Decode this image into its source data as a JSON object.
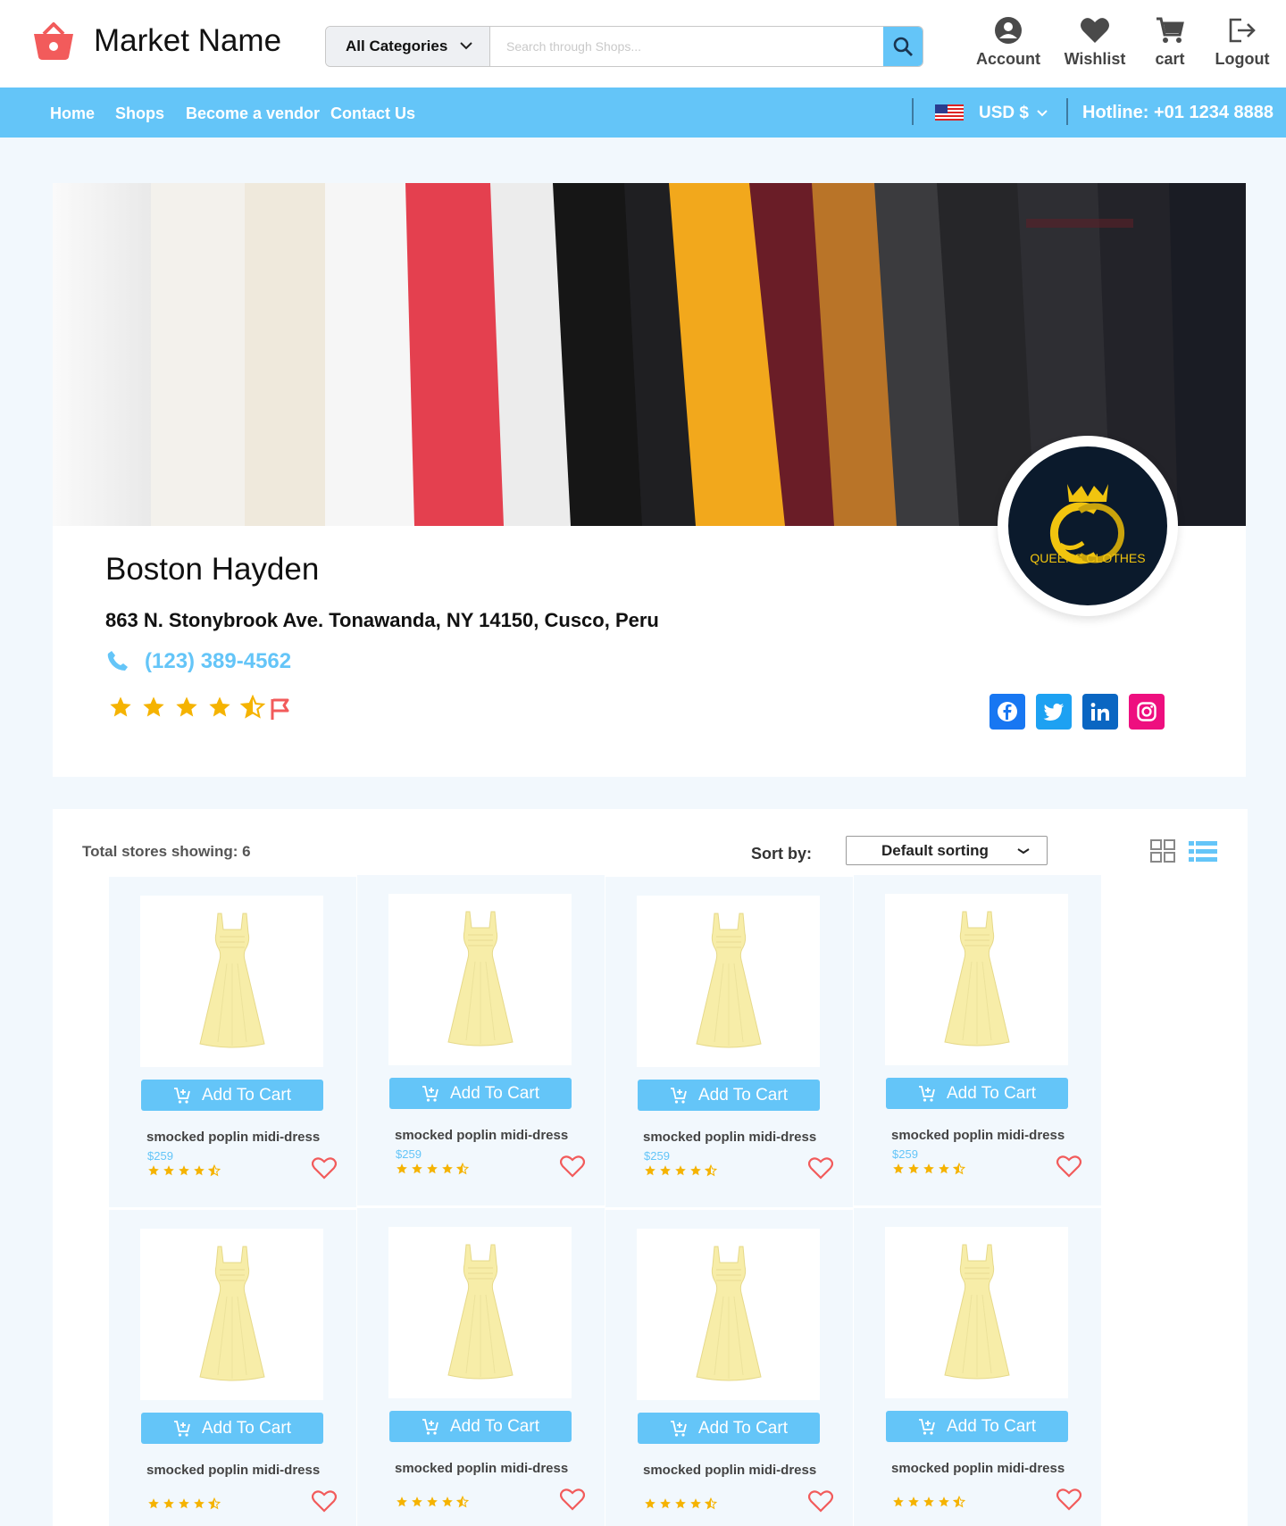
{
  "header": {
    "brand": "Market Name",
    "search": {
      "category": "All Categories",
      "placeholder": "Search through Shops..."
    },
    "actions": [
      {
        "label": "Account",
        "icon": "account-icon"
      },
      {
        "label": "Wishlist",
        "icon": "heart-icon"
      },
      {
        "label": "cart",
        "icon": "cart-icon"
      },
      {
        "label": "Logout",
        "icon": "logout-icon"
      }
    ]
  },
  "nav": {
    "links": [
      "Home",
      "Shops",
      "Become a vendor",
      "Contact Us"
    ],
    "currency": "USD $",
    "hotline": "Hotline: +01 1234 8888"
  },
  "vendor": {
    "name": "Boston Hayden",
    "address": "863 N. Stonybrook Ave. Tonawanda, NY 14150,  Cusco, Peru",
    "phone": "(123) 389-4562",
    "rating": 4.5,
    "logo_text": "QUEENS CLOTHES",
    "socials": [
      "facebook",
      "twitter",
      "linkedin",
      "instagram"
    ]
  },
  "listing": {
    "total_label": "Total stores showing: 6",
    "sort_label": "Sort by:",
    "sort_value": "Default sorting"
  },
  "products": [
    {
      "name": "smocked poplin midi-dress",
      "price": "$259",
      "rating": 4.5,
      "button": "Add To Cart"
    },
    {
      "name": "smocked poplin midi-dress",
      "price": "$259",
      "rating": 4.5,
      "button": "Add To Cart"
    },
    {
      "name": "smocked poplin midi-dress",
      "price": "$259",
      "rating": 4.5,
      "button": "Add To Cart"
    },
    {
      "name": "smocked poplin midi-dress",
      "price": "$259",
      "rating": 4.5,
      "button": "Add To Cart"
    },
    {
      "name": "smocked poplin midi-dress",
      "price": "",
      "rating": 4.5,
      "button": "Add To Cart"
    },
    {
      "name": "smocked poplin midi-dress",
      "price": "",
      "rating": 4.5,
      "button": "Add To Cart"
    },
    {
      "name": "smocked poplin midi-dress",
      "price": "",
      "rating": 4.5,
      "button": "Add To Cart"
    },
    {
      "name": "smocked poplin midi-dress",
      "price": "",
      "rating": 4.5,
      "button": "Add To Cart"
    }
  ],
  "colors": {
    "accent": "#64c5f8",
    "brand_red": "#f25b5b",
    "star": "#f5b301"
  }
}
